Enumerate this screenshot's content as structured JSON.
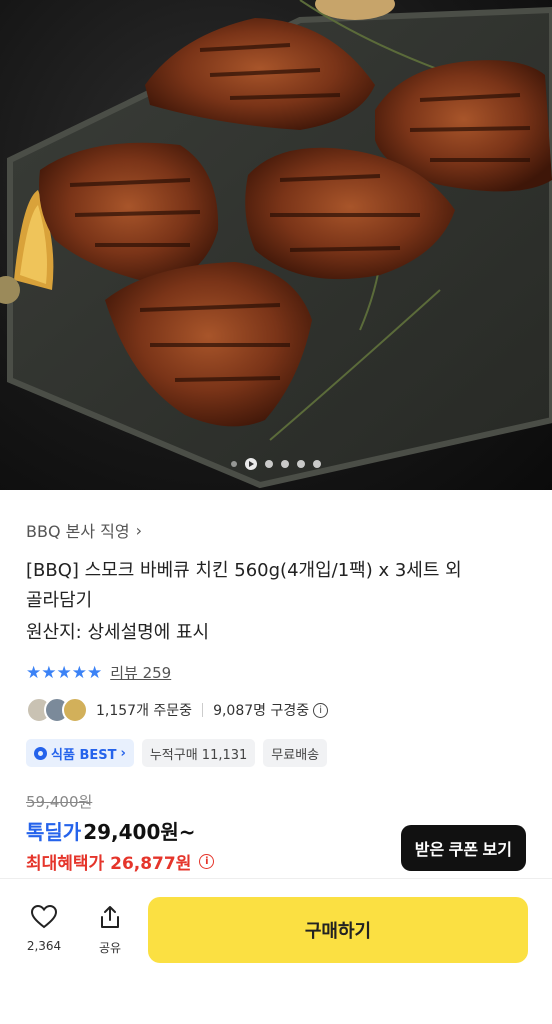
{
  "product": {
    "brand": "BBQ 본사 직영",
    "title_line1": "[BBQ] 스모크 바베큐 치킨 560g(4개입/1팩) x 3세트 외",
    "title_line2": "골라담기",
    "origin": "원산지: 상세설명에 표시",
    "rating_stars": "★★★★★",
    "review_text": "리뷰 259",
    "orders_text": "1,157개 주문중",
    "viewers_text": "9,087명 구경중",
    "tags": {
      "best": "식품 BEST",
      "cumulative": "누적구매 11,131",
      "shipping": "무료배송"
    }
  },
  "price": {
    "original": "59,400원",
    "deal_label": "톡딜가",
    "deal_amount": "29,400원~",
    "max_benefit": "최대혜택가 26,877원"
  },
  "coupon_button": "받은 쿠폰 보기",
  "bottom_bar": {
    "like_count": "2,364",
    "share_label": "공유",
    "buy_label": "구매하기"
  },
  "carousel": {
    "total": 6,
    "current": 1
  },
  "colors": {
    "accent_blue": "#2563eb",
    "accent_red": "#e5352b",
    "buy_yellow": "#fbe042"
  }
}
